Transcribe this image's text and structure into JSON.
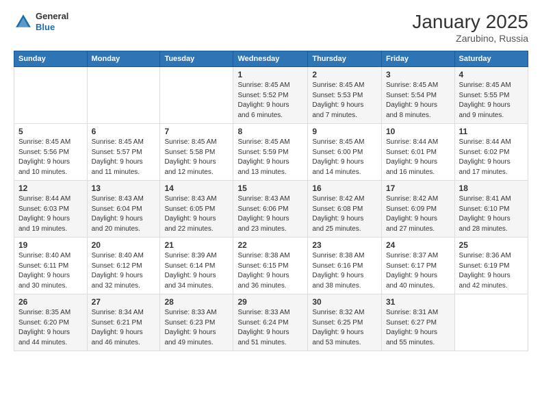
{
  "header": {
    "logo": {
      "general": "General",
      "blue": "Blue"
    },
    "title": "January 2025",
    "location": "Zarubino, Russia"
  },
  "calendar": {
    "weekdays": [
      "Sunday",
      "Monday",
      "Tuesday",
      "Wednesday",
      "Thursday",
      "Friday",
      "Saturday"
    ],
    "weeks": [
      [
        {
          "day": "",
          "info": ""
        },
        {
          "day": "",
          "info": ""
        },
        {
          "day": "",
          "info": ""
        },
        {
          "day": "1",
          "info": "Sunrise: 8:45 AM\nSunset: 5:52 PM\nDaylight: 9 hours\nand 6 minutes."
        },
        {
          "day": "2",
          "info": "Sunrise: 8:45 AM\nSunset: 5:53 PM\nDaylight: 9 hours\nand 7 minutes."
        },
        {
          "day": "3",
          "info": "Sunrise: 8:45 AM\nSunset: 5:54 PM\nDaylight: 9 hours\nand 8 minutes."
        },
        {
          "day": "4",
          "info": "Sunrise: 8:45 AM\nSunset: 5:55 PM\nDaylight: 9 hours\nand 9 minutes."
        }
      ],
      [
        {
          "day": "5",
          "info": "Sunrise: 8:45 AM\nSunset: 5:56 PM\nDaylight: 9 hours\nand 10 minutes."
        },
        {
          "day": "6",
          "info": "Sunrise: 8:45 AM\nSunset: 5:57 PM\nDaylight: 9 hours\nand 11 minutes."
        },
        {
          "day": "7",
          "info": "Sunrise: 8:45 AM\nSunset: 5:58 PM\nDaylight: 9 hours\nand 12 minutes."
        },
        {
          "day": "8",
          "info": "Sunrise: 8:45 AM\nSunset: 5:59 PM\nDaylight: 9 hours\nand 13 minutes."
        },
        {
          "day": "9",
          "info": "Sunrise: 8:45 AM\nSunset: 6:00 PM\nDaylight: 9 hours\nand 14 minutes."
        },
        {
          "day": "10",
          "info": "Sunrise: 8:44 AM\nSunset: 6:01 PM\nDaylight: 9 hours\nand 16 minutes."
        },
        {
          "day": "11",
          "info": "Sunrise: 8:44 AM\nSunset: 6:02 PM\nDaylight: 9 hours\nand 17 minutes."
        }
      ],
      [
        {
          "day": "12",
          "info": "Sunrise: 8:44 AM\nSunset: 6:03 PM\nDaylight: 9 hours\nand 19 minutes."
        },
        {
          "day": "13",
          "info": "Sunrise: 8:43 AM\nSunset: 6:04 PM\nDaylight: 9 hours\nand 20 minutes."
        },
        {
          "day": "14",
          "info": "Sunrise: 8:43 AM\nSunset: 6:05 PM\nDaylight: 9 hours\nand 22 minutes."
        },
        {
          "day": "15",
          "info": "Sunrise: 8:43 AM\nSunset: 6:06 PM\nDaylight: 9 hours\nand 23 minutes."
        },
        {
          "day": "16",
          "info": "Sunrise: 8:42 AM\nSunset: 6:08 PM\nDaylight: 9 hours\nand 25 minutes."
        },
        {
          "day": "17",
          "info": "Sunrise: 8:42 AM\nSunset: 6:09 PM\nDaylight: 9 hours\nand 27 minutes."
        },
        {
          "day": "18",
          "info": "Sunrise: 8:41 AM\nSunset: 6:10 PM\nDaylight: 9 hours\nand 28 minutes."
        }
      ],
      [
        {
          "day": "19",
          "info": "Sunrise: 8:40 AM\nSunset: 6:11 PM\nDaylight: 9 hours\nand 30 minutes."
        },
        {
          "day": "20",
          "info": "Sunrise: 8:40 AM\nSunset: 6:12 PM\nDaylight: 9 hours\nand 32 minutes."
        },
        {
          "day": "21",
          "info": "Sunrise: 8:39 AM\nSunset: 6:14 PM\nDaylight: 9 hours\nand 34 minutes."
        },
        {
          "day": "22",
          "info": "Sunrise: 8:38 AM\nSunset: 6:15 PM\nDaylight: 9 hours\nand 36 minutes."
        },
        {
          "day": "23",
          "info": "Sunrise: 8:38 AM\nSunset: 6:16 PM\nDaylight: 9 hours\nand 38 minutes."
        },
        {
          "day": "24",
          "info": "Sunrise: 8:37 AM\nSunset: 6:17 PM\nDaylight: 9 hours\nand 40 minutes."
        },
        {
          "day": "25",
          "info": "Sunrise: 8:36 AM\nSunset: 6:19 PM\nDaylight: 9 hours\nand 42 minutes."
        }
      ],
      [
        {
          "day": "26",
          "info": "Sunrise: 8:35 AM\nSunset: 6:20 PM\nDaylight: 9 hours\nand 44 minutes."
        },
        {
          "day": "27",
          "info": "Sunrise: 8:34 AM\nSunset: 6:21 PM\nDaylight: 9 hours\nand 46 minutes."
        },
        {
          "day": "28",
          "info": "Sunrise: 8:33 AM\nSunset: 6:23 PM\nDaylight: 9 hours\nand 49 minutes."
        },
        {
          "day": "29",
          "info": "Sunrise: 8:33 AM\nSunset: 6:24 PM\nDaylight: 9 hours\nand 51 minutes."
        },
        {
          "day": "30",
          "info": "Sunrise: 8:32 AM\nSunset: 6:25 PM\nDaylight: 9 hours\nand 53 minutes."
        },
        {
          "day": "31",
          "info": "Sunrise: 8:31 AM\nSunset: 6:27 PM\nDaylight: 9 hours\nand 55 minutes."
        },
        {
          "day": "",
          "info": ""
        }
      ]
    ]
  }
}
